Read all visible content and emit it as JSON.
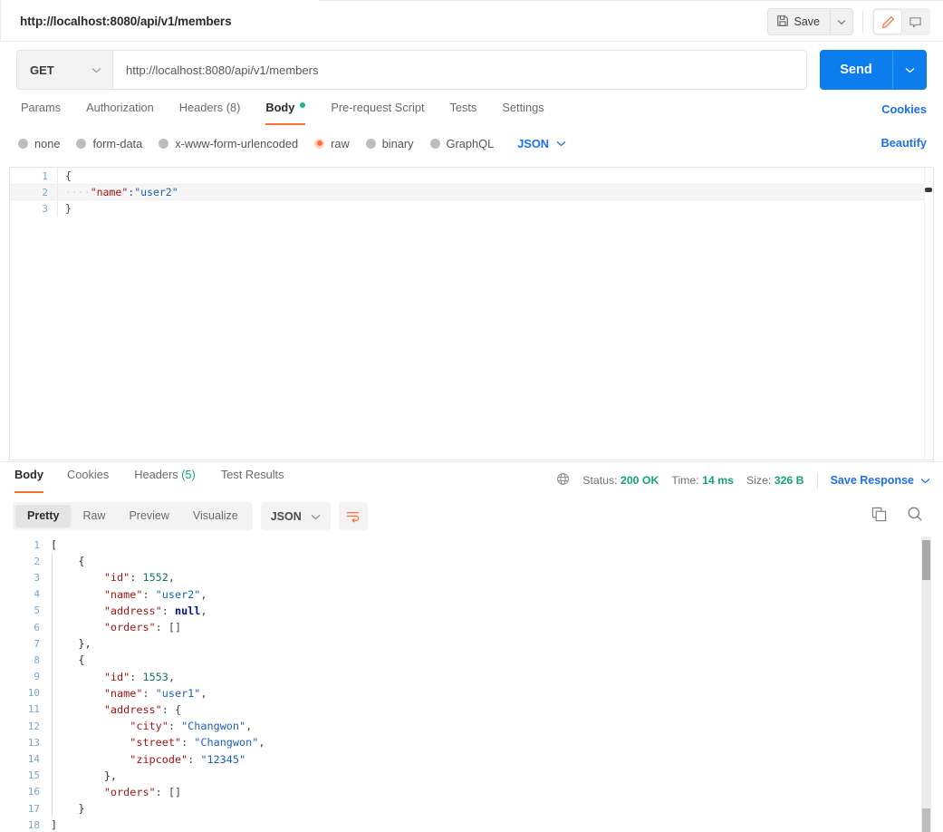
{
  "request": {
    "title": "http://localhost:8080/api/v1/members",
    "method": "GET",
    "url": "http://localhost:8080/api/v1/members",
    "save_label": "Save",
    "send_label": "Send",
    "tabs": [
      {
        "label": "Params",
        "active": false
      },
      {
        "label": "Authorization",
        "active": false
      },
      {
        "label": "Headers (8)",
        "active": false
      },
      {
        "label": "Body",
        "active": true,
        "dot": true
      },
      {
        "label": "Pre-request Script",
        "active": false
      },
      {
        "label": "Tests",
        "active": false
      },
      {
        "label": "Settings",
        "active": false
      }
    ],
    "cookies_link": "Cookies",
    "beautify_link": "Beautify",
    "body_types": [
      {
        "label": "none",
        "selected": false
      },
      {
        "label": "form-data",
        "selected": false
      },
      {
        "label": "x-www-form-urlencoded",
        "selected": false
      },
      {
        "label": "raw",
        "selected": true
      },
      {
        "label": "binary",
        "selected": false
      },
      {
        "label": "GraphQL",
        "selected": false
      }
    ],
    "format": "JSON",
    "body_lines": [
      {
        "n": "1",
        "text": "{"
      },
      {
        "n": "2",
        "text": "    \"name\":\"user2\"",
        "highlight": true
      },
      {
        "n": "3",
        "text": "}"
      }
    ]
  },
  "response": {
    "tabs": [
      {
        "label": "Body",
        "active": true
      },
      {
        "label": "Cookies",
        "active": false
      },
      {
        "label": "Headers",
        "count": "(5)",
        "active": false
      },
      {
        "label": "Test Results",
        "active": false
      }
    ],
    "status_label": "Status:",
    "status_value": "200 OK",
    "time_label": "Time:",
    "time_value": "14 ms",
    "size_label": "Size:",
    "size_value": "326 B",
    "save_response": "Save Response",
    "view_modes": [
      {
        "label": "Pretty",
        "active": true
      },
      {
        "label": "Raw",
        "active": false
      },
      {
        "label": "Preview",
        "active": false
      },
      {
        "label": "Visualize",
        "active": false
      }
    ],
    "format": "JSON",
    "body_lines": [
      {
        "n": "1",
        "indent": 0,
        "text": "["
      },
      {
        "n": "2",
        "indent": 1,
        "text": "{"
      },
      {
        "n": "3",
        "indent": 2,
        "key": "\"id\"",
        "sep": ": ",
        "num": "1552",
        "tail": ","
      },
      {
        "n": "4",
        "indent": 2,
        "key": "\"name\"",
        "sep": ": ",
        "str": "\"user2\"",
        "tail": ","
      },
      {
        "n": "5",
        "indent": 2,
        "key": "\"address\"",
        "sep": ": ",
        "nul": "null",
        "tail": ","
      },
      {
        "n": "6",
        "indent": 2,
        "key": "\"orders\"",
        "sep": ": ",
        "text2": "[]"
      },
      {
        "n": "7",
        "indent": 1,
        "text": "},"
      },
      {
        "n": "8",
        "indent": 1,
        "text": "{"
      },
      {
        "n": "9",
        "indent": 2,
        "key": "\"id\"",
        "sep": ": ",
        "num": "1553",
        "tail": ","
      },
      {
        "n": "10",
        "indent": 2,
        "key": "\"name\"",
        "sep": ": ",
        "str": "\"user1\"",
        "tail": ","
      },
      {
        "n": "11",
        "indent": 2,
        "key": "\"address\"",
        "sep": ": ",
        "text2": "{"
      },
      {
        "n": "12",
        "indent": 3,
        "key": "\"city\"",
        "sep": ": ",
        "str": "\"Changwon\"",
        "tail": ","
      },
      {
        "n": "13",
        "indent": 3,
        "key": "\"street\"",
        "sep": ": ",
        "str": "\"Changwon\"",
        "tail": ","
      },
      {
        "n": "14",
        "indent": 3,
        "key": "\"zipcode\"",
        "sep": ": ",
        "str": "\"12345\""
      },
      {
        "n": "15",
        "indent": 2,
        "text": "},"
      },
      {
        "n": "16",
        "indent": 2,
        "key": "\"orders\"",
        "sep": ": ",
        "text2": "[]"
      },
      {
        "n": "17",
        "indent": 1,
        "text": "}"
      },
      {
        "n": "18",
        "indent": 0,
        "text": "]"
      }
    ]
  },
  "colors": {
    "accent_orange": "#ff6c37",
    "blue": "#1b6ff0",
    "send_blue": "#0b7ded",
    "green": "#12a573",
    "json_key": "#a31515",
    "json_string": "#1b5fbe",
    "json_number": "#0d7a4f",
    "json_null": "#00128c"
  }
}
